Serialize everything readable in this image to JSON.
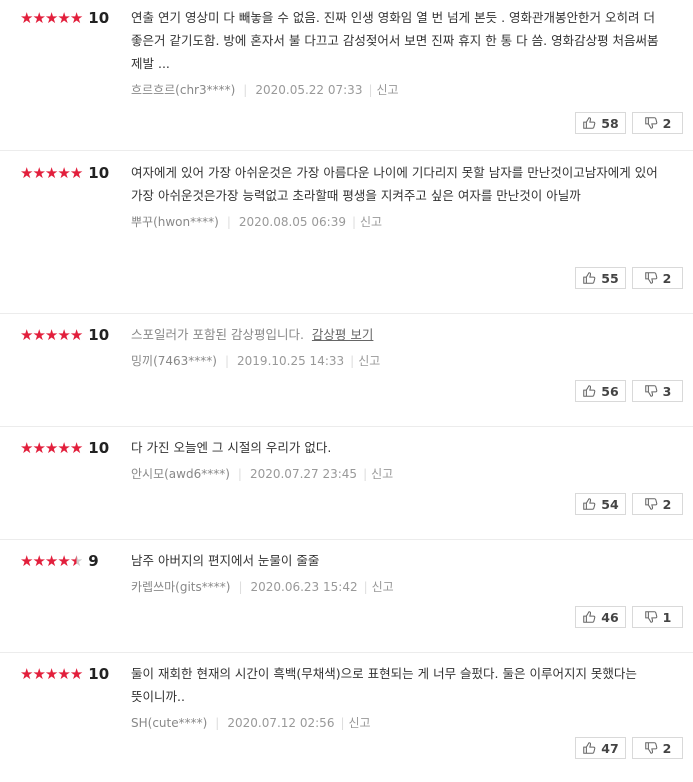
{
  "reviews": [
    {
      "stars": 5,
      "half": false,
      "score": "10",
      "text": "연출 연기 영상미 다 빼놓을 수 없음. 진짜 인생 영화임 열 번 넘게 본듯 . 영화관개봉안한거 오히려 더 좋은거 같기도함. 방에 혼자서 불 다끄고 감성젖어서 보면 진짜 휴지 한 통 다 씀. 영화감상평 처음써봄 제발 ...",
      "spoiler": false,
      "user": "흐르흐르(chr3****)",
      "date": "2020.05.22 07:33",
      "report": "신고",
      "likes": "58",
      "dislikes": "2"
    },
    {
      "stars": 5,
      "half": false,
      "score": "10",
      "text": "여자에게 있어 가장 아쉬운것은 가장 아름다운 나이에 기다리지 못할 남자를 만난것이고남자에게 있어 가장 아쉬운것은가장 능력없고 초라할때 평생을 지켜주고 싶은 여자를 만난것이 아닐까",
      "spoiler": false,
      "user": "뿌꾸(hwon****)",
      "date": "2020.08.05 06:39",
      "report": "신고",
      "likes": "55",
      "dislikes": "2"
    },
    {
      "stars": 5,
      "half": false,
      "score": "10",
      "text": "스포일러가 포함된 감상평입니다.",
      "spoiler": true,
      "spoiler_link": "감상평 보기",
      "user": "밍끼(7463****)",
      "date": "2019.10.25 14:33",
      "report": "신고",
      "likes": "56",
      "dislikes": "3"
    },
    {
      "stars": 5,
      "half": false,
      "score": "10",
      "text": "다 가진 오늘엔 그 시절의 우리가 없다.",
      "spoiler": false,
      "user": "안시모(awd6****)",
      "date": "2020.07.27 23:45",
      "report": "신고",
      "likes": "54",
      "dislikes": "2"
    },
    {
      "stars": 4,
      "half": true,
      "score": "9",
      "text": "남주 아버지의 편지에서 눈물이 줄줄",
      "spoiler": false,
      "user": "카렙쓰마(gits****)",
      "date": "2020.06.23 15:42",
      "report": "신고",
      "likes": "46",
      "dislikes": "1"
    },
    {
      "stars": 5,
      "half": false,
      "score": "10",
      "text": "둘이 재회한 현재의 시간이 흑백(무채색)으로 표현되는 게 너무 슬펐다. 둘은 이루어지지 못했다는 뜻이니까..",
      "spoiler": false,
      "user": "SH(cute****)",
      "date": "2020.07.12 02:56",
      "report": "신고",
      "likes": "47",
      "dislikes": "2"
    }
  ],
  "colors": {
    "star": "#e21f3c",
    "star_empty": "#cccccc"
  },
  "icons": {
    "like": "thumbs-up-icon",
    "dislike": "thumbs-down-icon"
  }
}
